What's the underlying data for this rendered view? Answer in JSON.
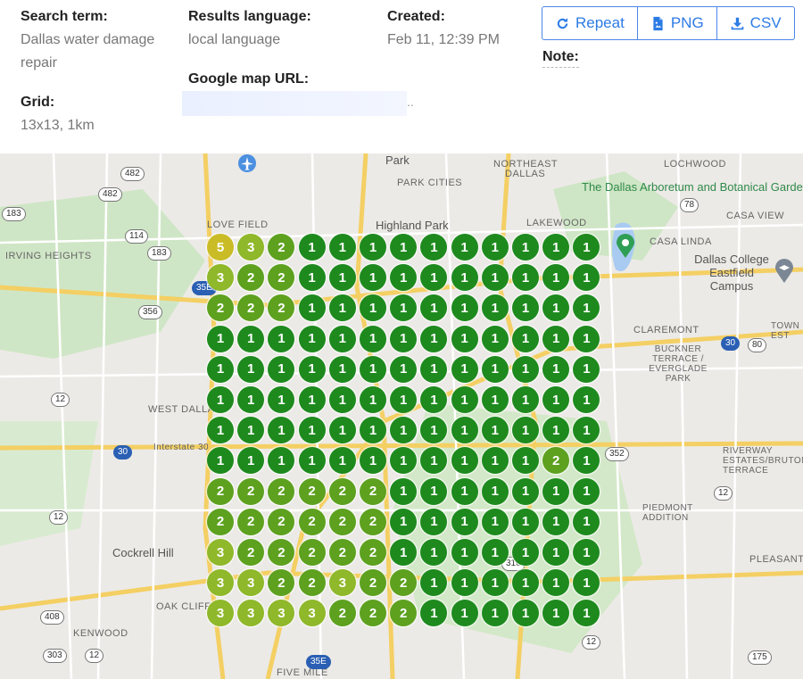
{
  "header": {
    "search_label": "Search term:",
    "search_value_line1": "Dallas water damage",
    "search_value_line2": "repair",
    "grid_label": "Grid:",
    "grid_value": "13x13, 1km",
    "lang_label": "Results language:",
    "lang_value": "local language",
    "url_label": "Google map URL:",
    "url_ellipsis": "..",
    "created_label": "Created:",
    "created_value": "Feb 11, 12:39 PM",
    "note_label": "Note:"
  },
  "buttons": {
    "repeat": "Repeat",
    "png": "PNG",
    "csv": "CSV"
  },
  "map_labels": {
    "park": "Park",
    "northeast_dallas": "NORTHEAST",
    "northeast_dallas2": "DALLAS",
    "lochwood": "LOCHWOOD",
    "park_cities": "PARK CITIES",
    "dallas_arboretum": "The Dallas Arboretum and Botanical Garden",
    "casa_view": "CASA VIEW",
    "love_field": "LOVE FIELD",
    "highland_park": "Highland Park",
    "lakewood": "LAKEWOOD",
    "casa_linda": "CASA LINDA",
    "irving_heights": "IRVING HEIGHTS",
    "dallas_college": "Dallas College Eastfield Campus",
    "claremont": "CLAREMONT",
    "buckner": "BUCKNER TERRACE / EVERGLADE PARK",
    "west_dallas": "WEST DALLAS",
    "dallas": "Dallas",
    "interstate30": "Interstate 30",
    "riverway": "RIVERWAY ESTATES/BRUTON TERRACE",
    "piedmont": "PIEDMONT ADDITION",
    "cockrell_hill": "Cockrell Hill",
    "pleasant": "PLEASANT",
    "oak_cliff": "OAK CLIFF",
    "kenwood": "KENWOOD",
    "five_mile": "FIVE MILE",
    "town_east": "TOWN EST"
  },
  "shields": [
    "482",
    "482",
    "183",
    "114",
    "183",
    "35E",
    "356",
    "12",
    "30",
    "12",
    "408",
    "303",
    "12",
    "30",
    "80",
    "78",
    "352",
    "12",
    "12",
    "175",
    "310",
    "35E"
  ],
  "colors": {
    "rank1": "#1e8a1e",
    "rank2": "#5da11f",
    "rank3": "#8fb82a",
    "rank5": "#c9bc26",
    "accent": "#2c7be5"
  },
  "rank_grid": [
    [
      5,
      3,
      2,
      1,
      1,
      1,
      1,
      1,
      1,
      1,
      1,
      1,
      1
    ],
    [
      3,
      2,
      2,
      1,
      1,
      1,
      1,
      1,
      1,
      1,
      1,
      1,
      1
    ],
    [
      2,
      2,
      2,
      1,
      1,
      1,
      1,
      1,
      1,
      1,
      1,
      1,
      1
    ],
    [
      1,
      1,
      1,
      1,
      1,
      1,
      1,
      1,
      1,
      1,
      1,
      1,
      1
    ],
    [
      1,
      1,
      1,
      1,
      1,
      1,
      1,
      1,
      1,
      1,
      1,
      1,
      1
    ],
    [
      1,
      1,
      1,
      1,
      1,
      1,
      1,
      1,
      1,
      1,
      1,
      1,
      1
    ],
    [
      1,
      1,
      1,
      1,
      1,
      1,
      1,
      1,
      1,
      1,
      1,
      1,
      1
    ],
    [
      1,
      1,
      1,
      1,
      1,
      1,
      1,
      1,
      1,
      1,
      1,
      2,
      1
    ],
    [
      2,
      2,
      2,
      2,
      2,
      2,
      1,
      1,
      1,
      1,
      1,
      1,
      1
    ],
    [
      2,
      2,
      2,
      2,
      2,
      2,
      1,
      1,
      1,
      1,
      1,
      1,
      1
    ],
    [
      3,
      2,
      2,
      2,
      2,
      2,
      1,
      1,
      1,
      1,
      1,
      1,
      1
    ],
    [
      3,
      3,
      2,
      2,
      3,
      2,
      2,
      1,
      1,
      1,
      1,
      1,
      1
    ],
    [
      3,
      3,
      3,
      3,
      2,
      2,
      2,
      1,
      1,
      1,
      1,
      1,
      1
    ]
  ]
}
